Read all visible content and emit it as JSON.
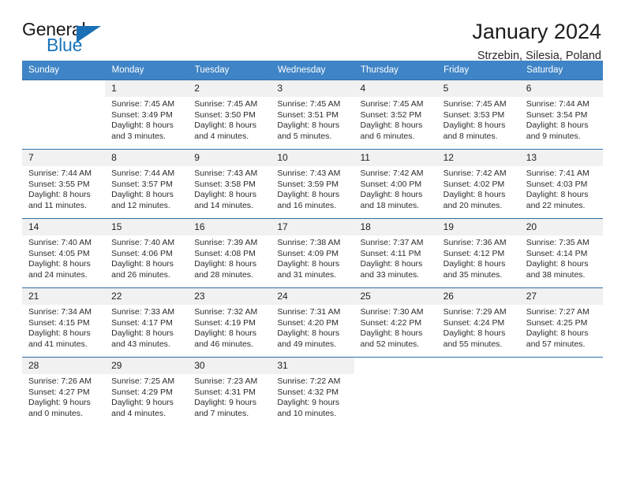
{
  "logo": {
    "word_top": "General",
    "word_bottom": "Blue",
    "triangle_color": "#1a6fb5",
    "blue_color": "#1a75bb"
  },
  "header": {
    "title": "January 2024",
    "location": "Strzebin, Silesia, Poland"
  },
  "theme": {
    "header_row_bg": "#3f84c6",
    "row_divider": "#2f6ea8",
    "daynum_bg": "#f1f1f1"
  },
  "weekday_headers": [
    "Sunday",
    "Monday",
    "Tuesday",
    "Wednesday",
    "Thursday",
    "Friday",
    "Saturday"
  ],
  "weeks": [
    [
      {
        "day": "",
        "sunrise": "",
        "sunset": "",
        "daylight_line1": "",
        "daylight_line2": ""
      },
      {
        "day": "1",
        "sunrise": "Sunrise: 7:45 AM",
        "sunset": "Sunset: 3:49 PM",
        "daylight_line1": "Daylight: 8 hours",
        "daylight_line2": "and 3 minutes."
      },
      {
        "day": "2",
        "sunrise": "Sunrise: 7:45 AM",
        "sunset": "Sunset: 3:50 PM",
        "daylight_line1": "Daylight: 8 hours",
        "daylight_line2": "and 4 minutes."
      },
      {
        "day": "3",
        "sunrise": "Sunrise: 7:45 AM",
        "sunset": "Sunset: 3:51 PM",
        "daylight_line1": "Daylight: 8 hours",
        "daylight_line2": "and 5 minutes."
      },
      {
        "day": "4",
        "sunrise": "Sunrise: 7:45 AM",
        "sunset": "Sunset: 3:52 PM",
        "daylight_line1": "Daylight: 8 hours",
        "daylight_line2": "and 6 minutes."
      },
      {
        "day": "5",
        "sunrise": "Sunrise: 7:45 AM",
        "sunset": "Sunset: 3:53 PM",
        "daylight_line1": "Daylight: 8 hours",
        "daylight_line2": "and 8 minutes."
      },
      {
        "day": "6",
        "sunrise": "Sunrise: 7:44 AM",
        "sunset": "Sunset: 3:54 PM",
        "daylight_line1": "Daylight: 8 hours",
        "daylight_line2": "and 9 minutes."
      }
    ],
    [
      {
        "day": "7",
        "sunrise": "Sunrise: 7:44 AM",
        "sunset": "Sunset: 3:55 PM",
        "daylight_line1": "Daylight: 8 hours",
        "daylight_line2": "and 11 minutes."
      },
      {
        "day": "8",
        "sunrise": "Sunrise: 7:44 AM",
        "sunset": "Sunset: 3:57 PM",
        "daylight_line1": "Daylight: 8 hours",
        "daylight_line2": "and 12 minutes."
      },
      {
        "day": "9",
        "sunrise": "Sunrise: 7:43 AM",
        "sunset": "Sunset: 3:58 PM",
        "daylight_line1": "Daylight: 8 hours",
        "daylight_line2": "and 14 minutes."
      },
      {
        "day": "10",
        "sunrise": "Sunrise: 7:43 AM",
        "sunset": "Sunset: 3:59 PM",
        "daylight_line1": "Daylight: 8 hours",
        "daylight_line2": "and 16 minutes."
      },
      {
        "day": "11",
        "sunrise": "Sunrise: 7:42 AM",
        "sunset": "Sunset: 4:00 PM",
        "daylight_line1": "Daylight: 8 hours",
        "daylight_line2": "and 18 minutes."
      },
      {
        "day": "12",
        "sunrise": "Sunrise: 7:42 AM",
        "sunset": "Sunset: 4:02 PM",
        "daylight_line1": "Daylight: 8 hours",
        "daylight_line2": "and 20 minutes."
      },
      {
        "day": "13",
        "sunrise": "Sunrise: 7:41 AM",
        "sunset": "Sunset: 4:03 PM",
        "daylight_line1": "Daylight: 8 hours",
        "daylight_line2": "and 22 minutes."
      }
    ],
    [
      {
        "day": "14",
        "sunrise": "Sunrise: 7:40 AM",
        "sunset": "Sunset: 4:05 PM",
        "daylight_line1": "Daylight: 8 hours",
        "daylight_line2": "and 24 minutes."
      },
      {
        "day": "15",
        "sunrise": "Sunrise: 7:40 AM",
        "sunset": "Sunset: 4:06 PM",
        "daylight_line1": "Daylight: 8 hours",
        "daylight_line2": "and 26 minutes."
      },
      {
        "day": "16",
        "sunrise": "Sunrise: 7:39 AM",
        "sunset": "Sunset: 4:08 PM",
        "daylight_line1": "Daylight: 8 hours",
        "daylight_line2": "and 28 minutes."
      },
      {
        "day": "17",
        "sunrise": "Sunrise: 7:38 AM",
        "sunset": "Sunset: 4:09 PM",
        "daylight_line1": "Daylight: 8 hours",
        "daylight_line2": "and 31 minutes."
      },
      {
        "day": "18",
        "sunrise": "Sunrise: 7:37 AM",
        "sunset": "Sunset: 4:11 PM",
        "daylight_line1": "Daylight: 8 hours",
        "daylight_line2": "and 33 minutes."
      },
      {
        "day": "19",
        "sunrise": "Sunrise: 7:36 AM",
        "sunset": "Sunset: 4:12 PM",
        "daylight_line1": "Daylight: 8 hours",
        "daylight_line2": "and 35 minutes."
      },
      {
        "day": "20",
        "sunrise": "Sunrise: 7:35 AM",
        "sunset": "Sunset: 4:14 PM",
        "daylight_line1": "Daylight: 8 hours",
        "daylight_line2": "and 38 minutes."
      }
    ],
    [
      {
        "day": "21",
        "sunrise": "Sunrise: 7:34 AM",
        "sunset": "Sunset: 4:15 PM",
        "daylight_line1": "Daylight: 8 hours",
        "daylight_line2": "and 41 minutes."
      },
      {
        "day": "22",
        "sunrise": "Sunrise: 7:33 AM",
        "sunset": "Sunset: 4:17 PM",
        "daylight_line1": "Daylight: 8 hours",
        "daylight_line2": "and 43 minutes."
      },
      {
        "day": "23",
        "sunrise": "Sunrise: 7:32 AM",
        "sunset": "Sunset: 4:19 PM",
        "daylight_line1": "Daylight: 8 hours",
        "daylight_line2": "and 46 minutes."
      },
      {
        "day": "24",
        "sunrise": "Sunrise: 7:31 AM",
        "sunset": "Sunset: 4:20 PM",
        "daylight_line1": "Daylight: 8 hours",
        "daylight_line2": "and 49 minutes."
      },
      {
        "day": "25",
        "sunrise": "Sunrise: 7:30 AM",
        "sunset": "Sunset: 4:22 PM",
        "daylight_line1": "Daylight: 8 hours",
        "daylight_line2": "and 52 minutes."
      },
      {
        "day": "26",
        "sunrise": "Sunrise: 7:29 AM",
        "sunset": "Sunset: 4:24 PM",
        "daylight_line1": "Daylight: 8 hours",
        "daylight_line2": "and 55 minutes."
      },
      {
        "day": "27",
        "sunrise": "Sunrise: 7:27 AM",
        "sunset": "Sunset: 4:25 PM",
        "daylight_line1": "Daylight: 8 hours",
        "daylight_line2": "and 57 minutes."
      }
    ],
    [
      {
        "day": "28",
        "sunrise": "Sunrise: 7:26 AM",
        "sunset": "Sunset: 4:27 PM",
        "daylight_line1": "Daylight: 9 hours",
        "daylight_line2": "and 0 minutes."
      },
      {
        "day": "29",
        "sunrise": "Sunrise: 7:25 AM",
        "sunset": "Sunset: 4:29 PM",
        "daylight_line1": "Daylight: 9 hours",
        "daylight_line2": "and 4 minutes."
      },
      {
        "day": "30",
        "sunrise": "Sunrise: 7:23 AM",
        "sunset": "Sunset: 4:31 PM",
        "daylight_line1": "Daylight: 9 hours",
        "daylight_line2": "and 7 minutes."
      },
      {
        "day": "31",
        "sunrise": "Sunrise: 7:22 AM",
        "sunset": "Sunset: 4:32 PM",
        "daylight_line1": "Daylight: 9 hours",
        "daylight_line2": "and 10 minutes."
      },
      {
        "day": "",
        "sunrise": "",
        "sunset": "",
        "daylight_line1": "",
        "daylight_line2": ""
      },
      {
        "day": "",
        "sunrise": "",
        "sunset": "",
        "daylight_line1": "",
        "daylight_line2": ""
      },
      {
        "day": "",
        "sunrise": "",
        "sunset": "",
        "daylight_line1": "",
        "daylight_line2": ""
      }
    ]
  ]
}
